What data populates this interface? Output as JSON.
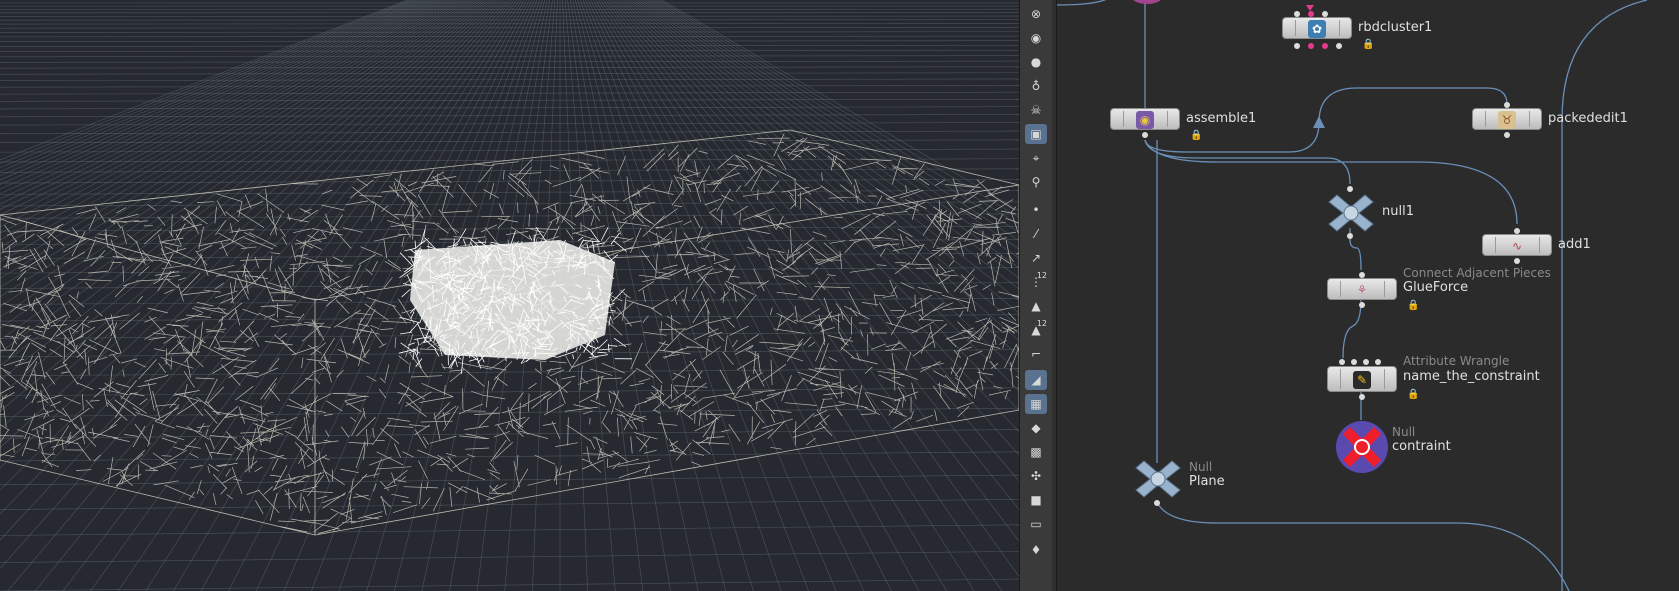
{
  "viewport": {
    "background": "#262a30",
    "grid_color": "#6c7480",
    "wire_color": "#cfcfc2",
    "highlight_color": "#ffffff"
  },
  "toolbar": {
    "buttons": [
      {
        "name": "close-icon",
        "glyph": "⊗"
      },
      {
        "name": "lighting-sphere-icon",
        "glyph": "◉"
      },
      {
        "name": "light-icon",
        "glyph": "●"
      },
      {
        "name": "bulb-icon",
        "glyph": "♁"
      },
      {
        "name": "skull-icon",
        "glyph": "☠"
      },
      {
        "name": "camera-icon",
        "glyph": "▣"
      },
      {
        "name": "view-handle-icon",
        "glyph": "⌖"
      },
      {
        "name": "snap-icon",
        "glyph": "⚲"
      },
      {
        "name": "point-display-icon",
        "glyph": "•"
      },
      {
        "name": "brush-icon",
        "glyph": "⁄"
      },
      {
        "name": "normal-icon",
        "glyph": "↗"
      },
      {
        "name": "point-numbers-icon",
        "glyph": "⋮",
        "mini": "12"
      },
      {
        "name": "prim-display-icon",
        "glyph": "▲"
      },
      {
        "name": "prim-numbers-icon",
        "glyph": "▲",
        "mini": "12"
      },
      {
        "name": "corner-icon",
        "glyph": "⌐"
      },
      {
        "name": "shaded-icon",
        "glyph": "◢"
      },
      {
        "name": "texture-icon",
        "glyph": "▦"
      },
      {
        "name": "diamond-icon",
        "glyph": "◆"
      },
      {
        "name": "group-icon",
        "glyph": "▩"
      },
      {
        "name": "handles-icon",
        "glyph": "✣"
      },
      {
        "name": "stop-icon",
        "glyph": "■"
      },
      {
        "name": "background-image-icon",
        "glyph": "▭"
      },
      {
        "name": "pin-icon",
        "glyph": "♦"
      }
    ]
  },
  "network": {
    "nodes": [
      {
        "id": "rbdcluster1",
        "label": "rbdcluster1",
        "type": "",
        "icon": "✿",
        "icon_color": "#3d7fb3"
      },
      {
        "id": "assemble1",
        "label": "assemble1",
        "type": "",
        "icon": "◉",
        "icon_color": "#7a5aa8"
      },
      {
        "id": "packededit1",
        "label": "packededit1",
        "type": "",
        "icon": "♉",
        "icon_color": "#c79a3a"
      },
      {
        "id": "null1",
        "label": "null1",
        "type": "",
        "icon": "",
        "icon_color": "#9ab0c8"
      },
      {
        "id": "add1",
        "label": "add1",
        "type": "",
        "icon": "∿",
        "icon_color": "#b04848"
      },
      {
        "id": "glueforce",
        "label": "GlueForce",
        "type": "Connect Adjacent Pieces",
        "icon": "⚘",
        "icon_color": "#b86a8a"
      },
      {
        "id": "name_the_constraint",
        "label": "name_the_constraint",
        "type": "Attribute Wrangle",
        "icon": "✎",
        "icon_color": "#d8b020"
      },
      {
        "id": "contraint",
        "label": "contraint",
        "type": "Null",
        "icon": "",
        "icon_color": "#e41e2a"
      },
      {
        "id": "plane",
        "label": "Plane",
        "type": "Null",
        "icon": "",
        "icon_color": "#9ab0c8"
      }
    ],
    "wire_color": "#6a8fb8"
  }
}
